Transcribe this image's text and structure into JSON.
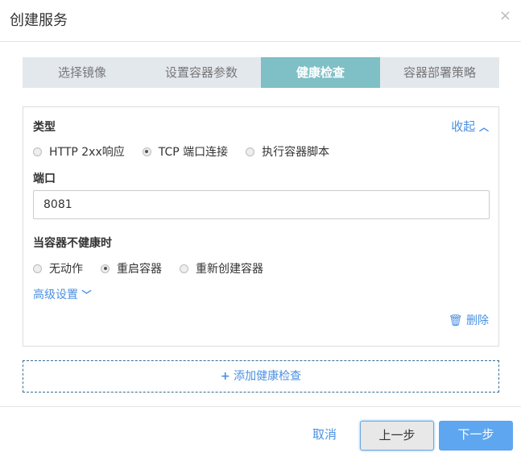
{
  "dialog": {
    "title": "创建服务",
    "close": "×"
  },
  "steps": [
    "选择镜像",
    "设置容器参数",
    "健康检查",
    "容器部署策略"
  ],
  "panel": {
    "type_label": "类型",
    "collapse": "收起",
    "types": [
      {
        "label": "HTTP 2xx响应",
        "checked": false
      },
      {
        "label": "TCP 端口连接",
        "checked": true
      },
      {
        "label": "执行容器脚本",
        "checked": false
      }
    ],
    "port_label": "端口",
    "port_value": "8081",
    "unhealthy_label": "当容器不健康时",
    "actions": [
      {
        "label": "无动作",
        "checked": false
      },
      {
        "label": "重启容器",
        "checked": true
      },
      {
        "label": "重新创建容器",
        "checked": false
      }
    ],
    "advanced": "高级设置",
    "delete": "删除"
  },
  "add_label": "添加健康检查",
  "footer": {
    "cancel": "取消",
    "prev": "上一步",
    "next": "下一步"
  }
}
